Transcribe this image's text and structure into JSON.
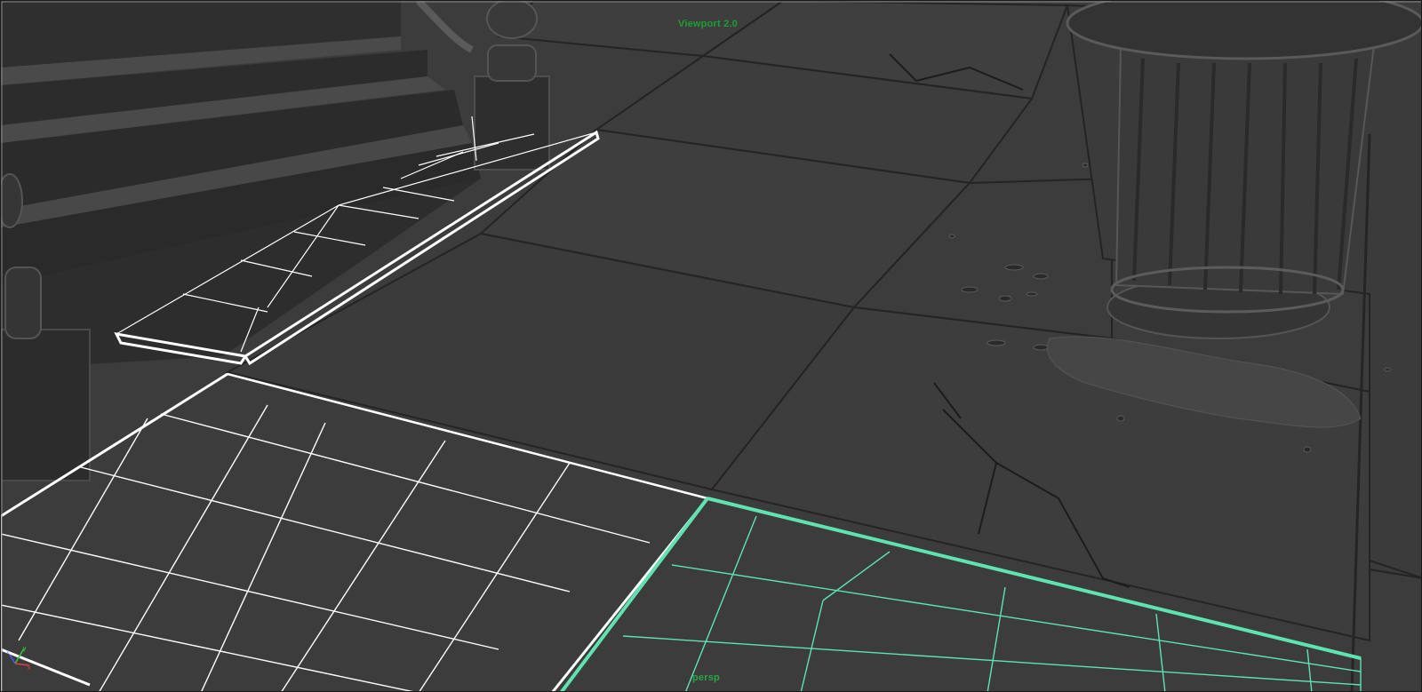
{
  "viewport": {
    "title": "Viewport 2.0",
    "camera": "persp",
    "background": "#3d3d3d",
    "wire_selected_color": "#5fe3b0",
    "wire_default_color": "#ffffff"
  },
  "axis": {
    "y_label": "y",
    "x_label": "x",
    "z_label": "z",
    "y_color": "#3bc43b",
    "x_color": "#e04040",
    "z_color": "#4060ff"
  },
  "objects": [
    {
      "name": "stairs",
      "icon": "stairs-mesh"
    },
    {
      "name": "railing-post",
      "icon": "post-mesh"
    },
    {
      "name": "trash-can",
      "icon": "trash-can-mesh"
    },
    {
      "name": "sidewalk-tiles",
      "icon": "tile-mesh"
    }
  ]
}
